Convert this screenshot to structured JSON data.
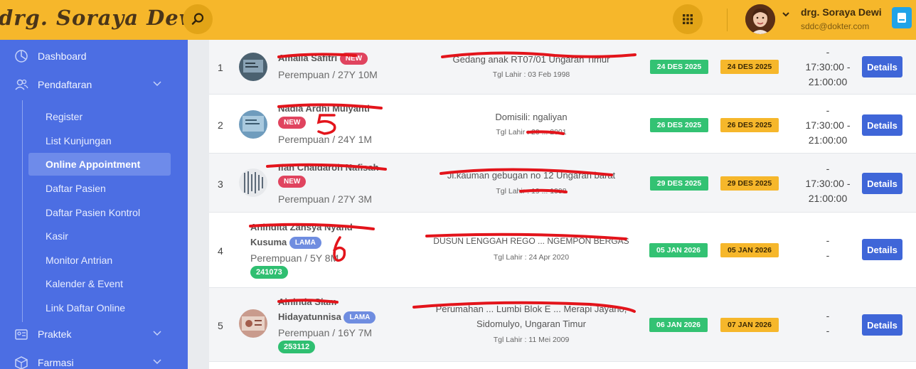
{
  "header": {
    "brand": "drg. Soraya Dewi",
    "user_name": "drg. Soraya Dewi",
    "user_email": "sddc@dokter.com",
    "icons": [
      "search-icon",
      "apps-grid-icon",
      "avatar",
      "chevron-down-icon",
      "notebook-icon"
    ]
  },
  "sidebar": {
    "items": [
      {
        "label": "Dashboard",
        "icon": "dashboard-icon"
      },
      {
        "label": "Pendaftaran",
        "icon": "users-icon"
      },
      {
        "label": "Praktek",
        "icon": "id-card-icon"
      },
      {
        "label": "Farmasi",
        "icon": "box-icon"
      }
    ],
    "sub_items": [
      "Register",
      "List Kunjungan",
      "Online Appointment",
      "Daftar Pasien",
      "Daftar Pasien Kontrol",
      "Kasir",
      "Monitor Antrian",
      "Kalender & Event",
      "Link Daftar Online"
    ],
    "active": "Online Appointment"
  },
  "rows": [
    {
      "no": "1",
      "name": "Amalia Safitri",
      "name2": "",
      "badge": "NEW",
      "gender_age": "Perempuan / 27Y 10M",
      "rm": "",
      "address": "Gedang anak RT07/01 Ungaran Timur",
      "address2": "",
      "dob": "Tgl Lahir : 03 Feb 1998",
      "date1": "24 DES 2025",
      "date2": "24 DES 2025",
      "time": [
        "-",
        "17:30:00 -",
        "21:00:00"
      ],
      "action": "Details"
    },
    {
      "no": "2",
      "name": "Nadia Ardhi Mulyanti",
      "name2": "",
      "badge": "NEW",
      "gender_age": "Perempuan / 24Y 1M",
      "rm": "",
      "address": "Domisili: ngaliyan",
      "address2": "",
      "dob": "Tgl Lahir : 20 ... 2001",
      "date1": "26 DES 2025",
      "date2": "26 DES 2025",
      "time": [
        "-",
        "17:30:00 -",
        "21:00:00"
      ],
      "action": "Details"
    },
    {
      "no": "3",
      "name": "Ifah Chaldaroh Nafisah",
      "name2": "",
      "badge": "NEW",
      "gender_age": "Perempuan / 27Y 3M",
      "rm": "",
      "address": "Jl.kauman gebugan no 12 Ungaran barat",
      "address2": "",
      "dob": "Tgl Lahir : 19 ... 1998",
      "date1": "29 DES 2025",
      "date2": "29 DES 2025",
      "time": [
        "-",
        "17:30:00 -",
        "21:00:00"
      ],
      "action": "Details"
    },
    {
      "no": "4",
      "name": "Anindita Zahsya Nyand",
      "name2": "Kusuma",
      "badge": "LAMA",
      "gender_age": "Perempuan / 5Y 8M",
      "rm": "241073",
      "address": "DUSUN LENGGAH REGO ... NGEMPON BERGAS",
      "address2": "",
      "dob": "Tgl Lahir : 24 Apr 2020",
      "date1": "05 JAN 2026",
      "date2": "05 JAN 2026",
      "time": [
        "-",
        "-"
      ],
      "action": "Details"
    },
    {
      "no": "5",
      "name": "Aininda Siam",
      "name2": "Hidayatunnisa",
      "badge": "LAMA",
      "gender_age": "Perempuan / 16Y 7M",
      "rm": "253112",
      "address": "Perumahan ... Lumbi Blok E ... Merapi Jayano,",
      "address2": "Sidomulyo, Ungaran Timur",
      "dob": "Tgl Lahir : 11 Mei 2009",
      "date1": "06 JAN 2026",
      "date2": "07 JAN 2026",
      "time": [
        "-",
        "-"
      ],
      "action": "Details"
    }
  ],
  "annotations": [
    "5",
    "6"
  ]
}
